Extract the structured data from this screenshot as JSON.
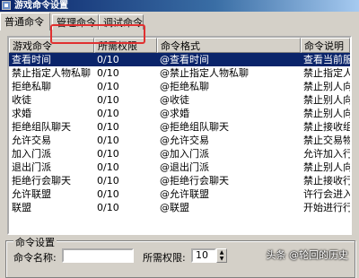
{
  "window": {
    "title": "游戏命令设置"
  },
  "tabs": [
    "普通命令",
    "管理命令",
    "调试命令"
  ],
  "table": {
    "headers": [
      "游戏命令",
      "所需权限",
      "命令格式",
      "命令说明"
    ],
    "rows": [
      [
        "查看时间",
        "0/10",
        "@查看时间",
        "查看当前服务器"
      ],
      [
        "禁止指定人物私聊",
        "0/10",
        "@禁止指定人物私聊",
        "禁止指定人物"
      ],
      [
        "拒绝私聊",
        "0/10",
        "@拒绝私聊",
        "禁止别人向自己"
      ],
      [
        "收徒",
        "0/10",
        "@收徒",
        "禁止别人向自己"
      ],
      [
        "求婚",
        "0/10",
        "@求婚",
        "禁止别人向自己"
      ],
      [
        "拒绝组队聊天",
        "0/10",
        "@拒绝组队聊天",
        "禁止接收组队"
      ],
      [
        "允许交易",
        "0/10",
        "@允许交易",
        "禁止交易物品"
      ],
      [
        "加入门派",
        "0/10",
        "@加入门派",
        "允许加入行会"
      ],
      [
        "退出门派",
        "0/10",
        "@退出门派",
        "禁止别人向自己"
      ],
      [
        "拒绝行会聊天",
        "0/10",
        "@拒绝行会聊天",
        "禁止接收行会"
      ],
      [
        "允许联盟",
        "0/10",
        "@允许联盟",
        "许行会进入联盟"
      ],
      [
        "联盟",
        "0/10",
        "@联盟",
        "开始进行行会"
      ]
    ],
    "selected_row": 0
  },
  "settings": {
    "group_label": "命令设置",
    "name_label": "命令名称:",
    "name_value": "",
    "permission_label": "所需权限:",
    "permission_value": "10"
  },
  "watermark": "头条 @轮回的历史"
}
